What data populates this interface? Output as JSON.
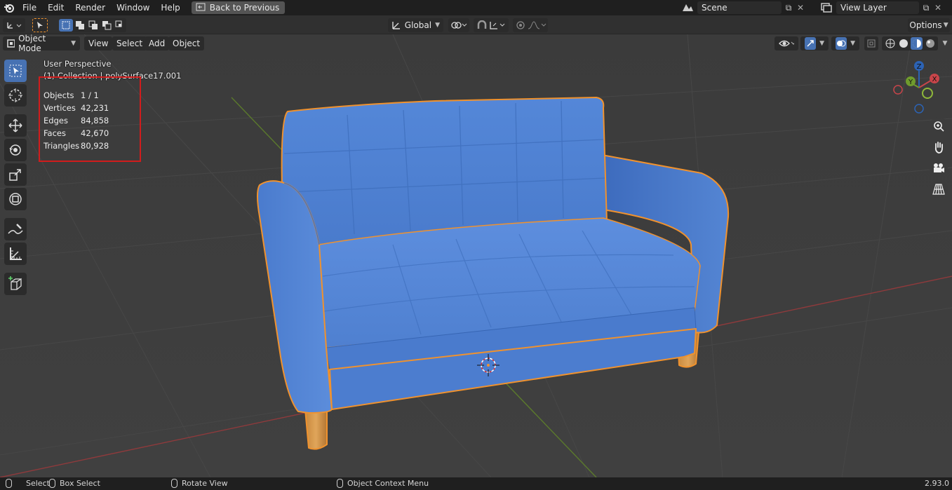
{
  "menubar": {
    "items": [
      "File",
      "Edit",
      "Render",
      "Window",
      "Help"
    ],
    "back_button": "Back to Previous",
    "scene": "Scene",
    "view_layer": "View Layer"
  },
  "header": {
    "orientation": "Global",
    "options": "Options"
  },
  "viewport_header": {
    "mode": "Object Mode",
    "menus": [
      "View",
      "Select",
      "Add",
      "Object"
    ]
  },
  "overlay": {
    "perspective": "User Perspective",
    "collection": "(1) Collection | polySurface17.001",
    "stats": [
      {
        "label": "Objects",
        "value": "1 / 1"
      },
      {
        "label": "Vertices",
        "value": "42,231"
      },
      {
        "label": "Edges",
        "value": "84,858"
      },
      {
        "label": "Faces",
        "value": "42,670"
      },
      {
        "label": "Triangles",
        "value": "80,928"
      }
    ]
  },
  "gizmo": {
    "x": "X",
    "y": "Y",
    "z": "Z"
  },
  "statusbar": {
    "select": "Select",
    "box_select": "Box Select",
    "rotate_view": "Rotate View",
    "context_menu": "Object Context Menu",
    "version": "2.93.0"
  },
  "colors": {
    "sofa": "#4f7fd1",
    "selection_outline": "#f0922e",
    "active_tool": "#4772b3",
    "x_axis": "#c8454a",
    "y_axis": "#6f9b2d"
  }
}
